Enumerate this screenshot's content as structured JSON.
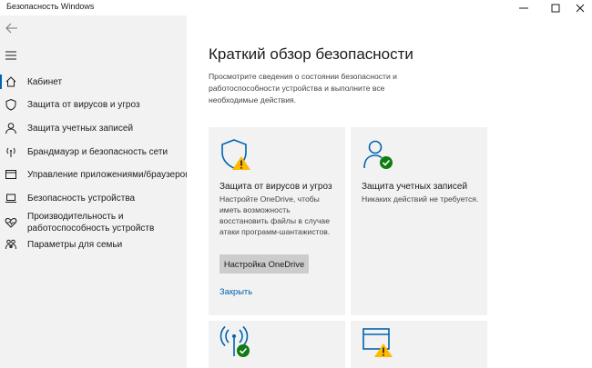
{
  "window": {
    "title": "Безопасность Windows"
  },
  "sidebar": {
    "items": [
      {
        "label": "Кабинет",
        "icon": "home-icon"
      },
      {
        "label": "Защита от вирусов и угроз",
        "icon": "shield-icon"
      },
      {
        "label": "Защита учетных записей",
        "icon": "person-icon"
      },
      {
        "label": "Брандмауэр и безопасность сети",
        "icon": "antenna-icon"
      },
      {
        "label": "Управление приложениями/браузером",
        "icon": "browser-icon"
      },
      {
        "label": "Безопасность устройства",
        "icon": "laptop-icon"
      },
      {
        "label": "Производительность и",
        "label2": "работоспособность устройств",
        "icon": "heart-icon"
      },
      {
        "label": "Параметры для семьи",
        "icon": "family-icon"
      }
    ]
  },
  "main": {
    "title": "Краткий обзор безопасности",
    "description": "Просмотрите сведения о состоянии безопасности и работоспособности устройства и выполните все необходимые действия.",
    "cards": [
      {
        "title": "Защита от вирусов и угроз",
        "text": "Настройте OneDrive, чтобы иметь возможность восстановить файлы в случае атаки программ-шантажистов.",
        "button": "Настройка OneDrive",
        "link": "Закрыть",
        "status": "warning"
      },
      {
        "title": "Защита учетных записей",
        "text": "Никаких действий не требуется.",
        "status": "ok"
      },
      {
        "status": "ok"
      },
      {
        "status": "warning"
      }
    ]
  },
  "colors": {
    "accent": "#0063b1",
    "ok": "#107c10",
    "warning": "#ffb900",
    "sidebar_bg": "#f2f2f2",
    "card_bg": "#f2f2f2"
  }
}
